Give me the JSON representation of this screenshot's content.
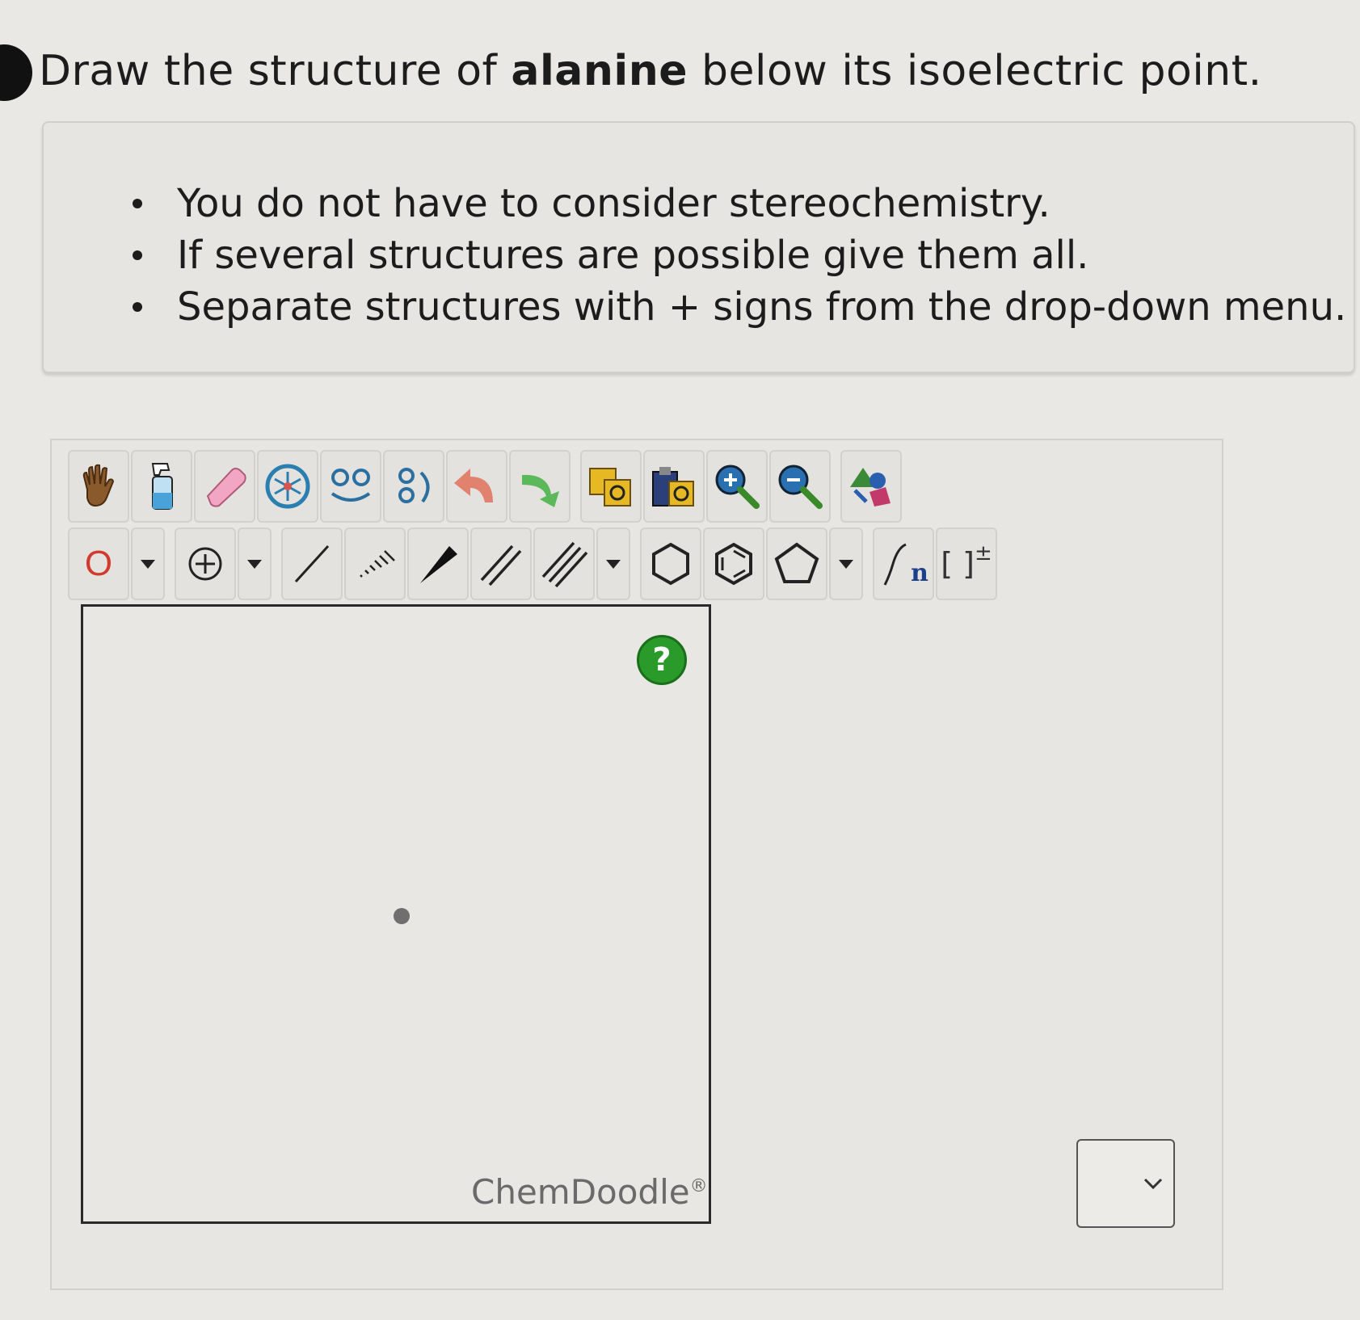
{
  "question": {
    "prefix": "Draw the structure of ",
    "bold": "alanine",
    "suffix": " below its isoelectric point."
  },
  "instructions": [
    "You do not have to consider stereochemistry.",
    "If several structures are possible give them all.",
    "Separate structures with + signs from the drop-down menu."
  ],
  "toolbar": {
    "element_label": "O",
    "template_label_sub": "n",
    "bracket_label": "[ ]",
    "bracket_charge": "±"
  },
  "canvas": {
    "help_label": "?",
    "watermark": "ChemDoodle",
    "watermark_mark": "®"
  },
  "separator_select": {
    "value": ""
  },
  "colors": {
    "help_green": "#2a9a2a",
    "element_red": "#d23a2e",
    "undo_red": "#e0826e",
    "redo_green": "#5bb85b"
  }
}
